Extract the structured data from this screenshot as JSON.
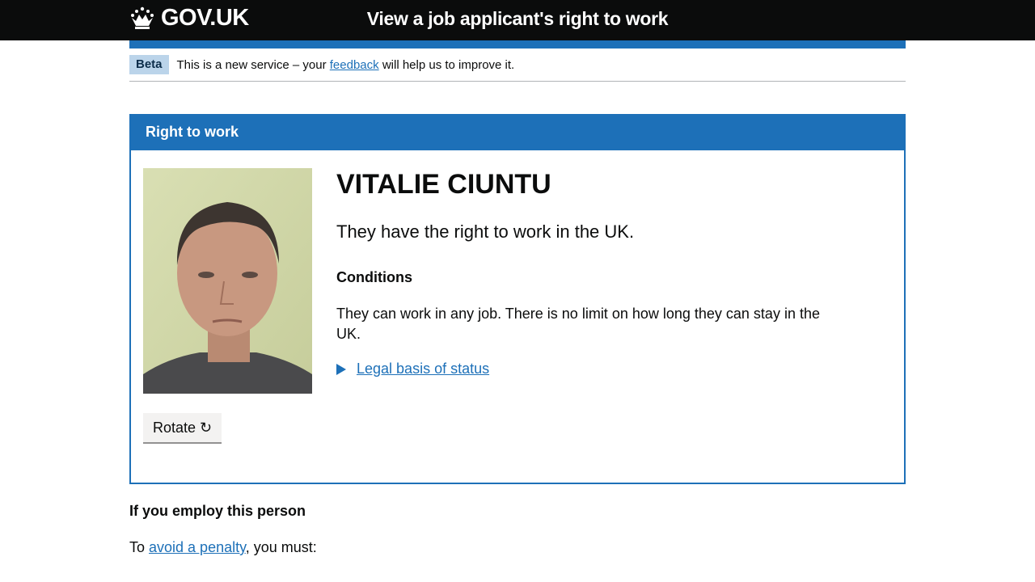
{
  "header": {
    "logo_text": "GOV.UK",
    "service_name": "View a job applicant's right to work"
  },
  "phase_banner": {
    "tag": "Beta",
    "text_before": "This is a new service – your ",
    "link": "feedback",
    "text_after": " will help us to improve it."
  },
  "panel": {
    "heading": "Right to work",
    "name": "VITALIE CIUNTU",
    "status": "They have the right to work in the UK.",
    "conditions_heading": "Conditions",
    "conditions_text": "They can work in any job. There is no limit on how long they can stay in the UK.",
    "legal_basis_link": "Legal basis of status",
    "rotate_button": "Rotate ↻"
  },
  "employ": {
    "heading": "If you employ this person",
    "text_before": "To ",
    "link": "avoid a penalty",
    "text_after": ", you must:"
  },
  "colors": {
    "header_bg": "#0b0c0c",
    "brand_blue": "#1d70b8",
    "tag_bg": "#bbd4ea"
  }
}
